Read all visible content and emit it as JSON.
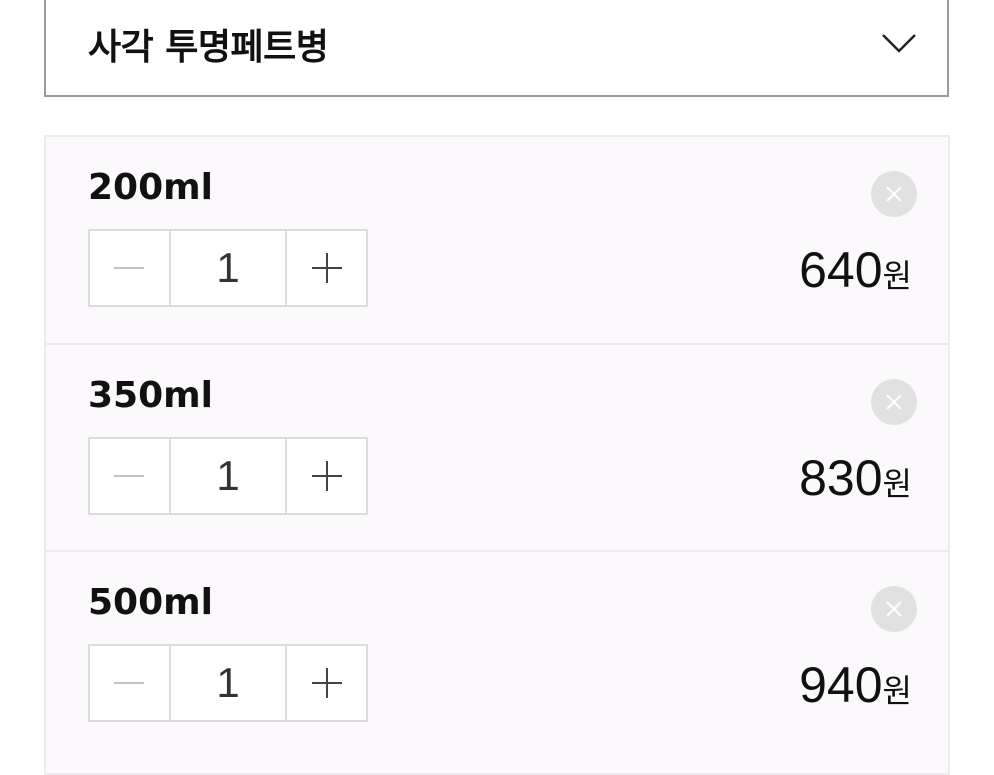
{
  "select": {
    "value": "사각 투명페트병",
    "icon": "chevron-down-icon"
  },
  "options": [
    {
      "label": "200ml",
      "quantity": "1",
      "price": "640",
      "currency": "원"
    },
    {
      "label": "350ml",
      "quantity": "1",
      "price": "830",
      "currency": "원"
    },
    {
      "label": "500ml",
      "quantity": "1",
      "price": "940",
      "currency": "원"
    }
  ],
  "colors": {
    "panel_background": "#fcf9fc",
    "remove_button": "#e2e1e2",
    "stepper_border": "#dcdcdc"
  }
}
